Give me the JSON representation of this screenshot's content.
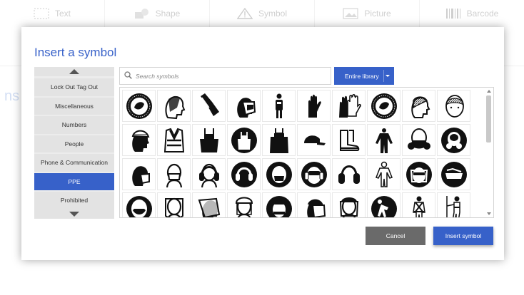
{
  "background_toolbar": {
    "items": [
      {
        "label": "Text",
        "icon": "text-box-icon"
      },
      {
        "label": "Shape",
        "icon": "shape-icon"
      },
      {
        "label": "Symbol",
        "icon": "warning-triangle-icon"
      },
      {
        "label": "Picture",
        "icon": "picture-icon"
      },
      {
        "label": "Barcode",
        "icon": "barcode-icon"
      }
    ],
    "side_text": "ns"
  },
  "dialog": {
    "title": "Insert a symbol",
    "categories": [
      {
        "label": "Lock Out Tag Out",
        "active": false
      },
      {
        "label": "Miscellaneous",
        "active": false
      },
      {
        "label": "Numbers",
        "active": false
      },
      {
        "label": "People",
        "active": false
      },
      {
        "label": "Phone & Communication",
        "active": false
      },
      {
        "label": "PPE",
        "active": true
      },
      {
        "label": "Prohibited",
        "active": false
      }
    ],
    "search": {
      "placeholder": "Search symbols",
      "value": ""
    },
    "library_button": "Entire library",
    "symbols": [
      [
        "round-seal-icon",
        "head-mesh-hood-icon",
        "sleeve-glove-icon",
        "welding-mask-icon",
        "worker-figure-icon",
        "glove-icon",
        "gloves-pair-icon",
        "round-seal-icon",
        "head-hairnet-icon",
        "hairnet-head-icon"
      ],
      [
        "head-helmet-profile-icon",
        "high-vis-vest-icon",
        "apron-icon",
        "apron-circle-icon",
        "apron-long-icon",
        "cap-icon",
        "boots-icon",
        "coverall-icon",
        "respirator-mask-icon",
        "full-face-respirator-icon"
      ],
      [
        "face-mask-profile-icon",
        "face-mask-front-icon",
        "ear-muffs-icon",
        "ear-muffs-circle-icon",
        "dust-mask-circle-icon",
        "goggles-earmuffs-icon",
        "ear-muffs-plain-icon",
        "hazmat-suit-icon",
        "face-shield-circle-icon",
        "safety-glasses-circle-icon"
      ],
      [
        "mask-circle-icon",
        "face-shield-icon",
        "face-shield-visor-icon",
        "helmet-shield-icon",
        "head-circle-icon",
        "visor-helmet-icon",
        "helmet-face-shield-icon",
        "worker-bending-icon",
        "harness-icon",
        "harness-climbing-icon"
      ]
    ],
    "cancel_label": "Cancel",
    "insert_label": "Insert symbol",
    "accent_color": "#3761c9"
  }
}
